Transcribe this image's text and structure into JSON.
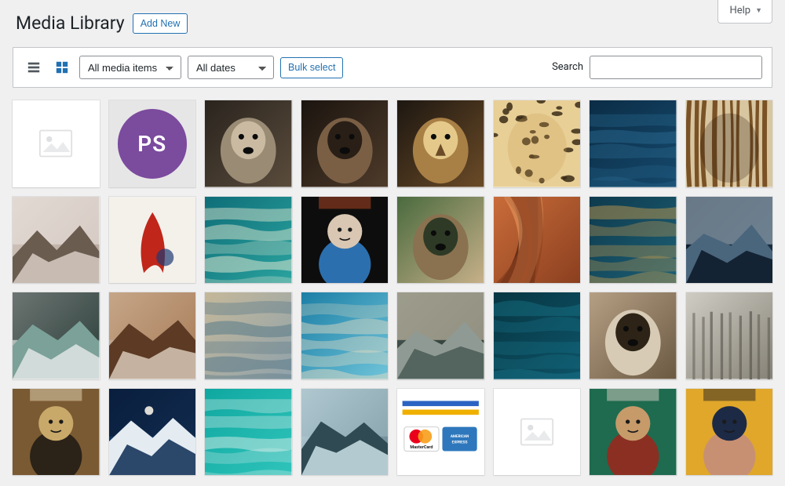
{
  "help": {
    "label": "Help"
  },
  "page": {
    "title": "Media Library",
    "add_new_label": "Add New"
  },
  "toolbar": {
    "view_list_name": "list-view",
    "view_grid_name": "grid-view",
    "filter_type": {
      "selected": "All media items"
    },
    "filter_date": {
      "selected": "All dates"
    },
    "bulk_select_label": "Bulk select",
    "search_label": "Search"
  },
  "media": [
    {
      "kind": "placeholder"
    },
    {
      "kind": "ps-badge",
      "text": "PS"
    },
    {
      "kind": "photo",
      "name": "wolf-snarl",
      "palette": [
        "#2a241e",
        "#5a4c3c",
        "#9a8b74",
        "#c9baa1"
      ],
      "shape": "animal"
    },
    {
      "kind": "photo",
      "name": "bear-portrait",
      "palette": [
        "#1b140f",
        "#4e3b2a",
        "#7a5f45",
        "#2a1f16"
      ],
      "shape": "animal"
    },
    {
      "kind": "photo",
      "name": "eagle",
      "palette": [
        "#1d1711",
        "#6b4b27",
        "#a87f45",
        "#e4c98a"
      ],
      "shape": "bird"
    },
    {
      "kind": "photo",
      "name": "leopard",
      "palette": [
        "#c99b52",
        "#3a2c16",
        "#e8cf96",
        "#8a6a34"
      ],
      "shape": "spotted"
    },
    {
      "kind": "photo",
      "name": "ocean-swimmer-1",
      "palette": [
        "#0b2d46",
        "#15486b",
        "#2c6d94",
        "#a9c4d3"
      ],
      "shape": "water"
    },
    {
      "kind": "photo",
      "name": "zebra",
      "palette": [
        "#241508",
        "#7a5225",
        "#d8c6a0",
        "#ffffff"
      ],
      "shape": "stripes"
    },
    {
      "kind": "photo",
      "name": "misty-elk",
      "palette": [
        "#d7cbc3",
        "#b2a196",
        "#6b5c50",
        "#e9e3dd"
      ],
      "shape": "haze"
    },
    {
      "kind": "photo",
      "name": "red-splash-art",
      "palette": [
        "#f4f1eb",
        "#c0261a",
        "#1f3a74",
        "#8e8273"
      ],
      "shape": "splash"
    },
    {
      "kind": "photo",
      "name": "aerial-coast",
      "palette": [
        "#0f6e78",
        "#2aa39f",
        "#d9e3cd",
        "#5d8f7a"
      ],
      "shape": "aerial"
    },
    {
      "kind": "photo",
      "name": "face-paint",
      "palette": [
        "#0d0d0d",
        "#d9c7b3",
        "#2c6fae",
        "#b84a27"
      ],
      "shape": "portrait"
    },
    {
      "kind": "photo",
      "name": "deer",
      "palette": [
        "#4a6a3e",
        "#c7b089",
        "#8a714f",
        "#2e3a25"
      ],
      "shape": "animal"
    },
    {
      "kind": "photo",
      "name": "antelope-canyon",
      "palette": [
        "#c96c3a",
        "#8b3f1f",
        "#5a2813",
        "#e79a5f"
      ],
      "shape": "canyon"
    },
    {
      "kind": "photo",
      "name": "sea-snake",
      "palette": [
        "#0e3a4d",
        "#1d6075",
        "#d6a24b",
        "#2b7d90"
      ],
      "shape": "water"
    },
    {
      "kind": "photo",
      "name": "moonscape",
      "palette": [
        "#0b1726",
        "#1d3448",
        "#4a667d",
        "#a7b9c6"
      ],
      "shape": "mountain"
    },
    {
      "kind": "photo",
      "name": "alpine-lake",
      "palette": [
        "#e1e5e4",
        "#3a5a52",
        "#7ba198",
        "#1e2a26"
      ],
      "shape": "mountain"
    },
    {
      "kind": "photo",
      "name": "desert-buttes",
      "palette": [
        "#d7c8b6",
        "#8b5a3a",
        "#5c3a24",
        "#b98f69"
      ],
      "shape": "rock"
    },
    {
      "kind": "photo",
      "name": "braided-river",
      "palette": [
        "#c5b89a",
        "#8fa2ab",
        "#5f7e8b",
        "#d9d2bc"
      ],
      "shape": "aerial"
    },
    {
      "kind": "photo",
      "name": "beach-aerial",
      "palette": [
        "#1c7fa6",
        "#6fc4d9",
        "#e8dcc2",
        "#c9b893"
      ],
      "shape": "aerial"
    },
    {
      "kind": "photo",
      "name": "mountain-cabin",
      "palette": [
        "#4a5a55",
        "#2a3530",
        "#8f9a94",
        "#d6cab2"
      ],
      "shape": "mountain"
    },
    {
      "kind": "photo",
      "name": "ocean-swimmer-2",
      "palette": [
        "#073642",
        "#0d5368",
        "#1a7d93",
        "#3ca2b6"
      ],
      "shape": "water"
    },
    {
      "kind": "photo",
      "name": "monkey",
      "palette": [
        "#b59f84",
        "#6b5942",
        "#d8cbb5",
        "#2d2417"
      ],
      "shape": "animal"
    },
    {
      "kind": "photo",
      "name": "foggy-forest",
      "palette": [
        "#cfcdc5",
        "#6e6a5d",
        "#3a382f",
        "#9b9688"
      ],
      "shape": "forest"
    },
    {
      "kind": "photo",
      "name": "butterfly-eye",
      "palette": [
        "#7a5a32",
        "#c9a96a",
        "#2b2218",
        "#e5d7b7"
      ],
      "shape": "portrait"
    },
    {
      "kind": "photo",
      "name": "lighthouse-night",
      "palette": [
        "#0b2a52",
        "#1d4e82",
        "#e4ecf2",
        "#0a1830"
      ],
      "shape": "night"
    },
    {
      "kind": "photo",
      "name": "turquoise-pier",
      "palette": [
        "#0fa8a0",
        "#2fc4bb",
        "#e9f1ee",
        "#0a6d67"
      ],
      "shape": "water"
    },
    {
      "kind": "photo",
      "name": "valley-vista",
      "palette": [
        "#cbe0e8",
        "#5b7a86",
        "#2f4a53",
        "#9cb8c0"
      ],
      "shape": "mountain"
    },
    {
      "kind": "cards",
      "name": "payment-cards",
      "labels": [
        "MasterCard",
        "AMERICAN EXPRESS"
      ]
    },
    {
      "kind": "placeholder"
    },
    {
      "kind": "photo",
      "name": "woman-green-coat",
      "palette": [
        "#1e6b4f",
        "#c79a6a",
        "#8b2f23",
        "#d8cfc3"
      ],
      "shape": "portrait"
    },
    {
      "kind": "photo",
      "name": "man-cap",
      "palette": [
        "#e0a72a",
        "#1d2a46",
        "#c89072",
        "#2a2420"
      ],
      "shape": "portrait"
    }
  ]
}
